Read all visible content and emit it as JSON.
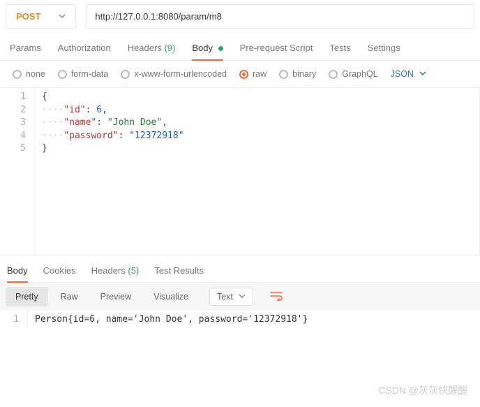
{
  "request": {
    "method": "POST",
    "url": "http://127.0.0.1:8080/param/m8"
  },
  "mainTabs": {
    "params": "Params",
    "authorization": "Authorization",
    "headers": "Headers",
    "headersCount": "(9)",
    "body": "Body",
    "prerequest": "Pre-request Script",
    "tests": "Tests",
    "settings": "Settings"
  },
  "bodyTypes": {
    "none": "none",
    "formdata": "form-data",
    "xwww": "x-www-form-urlencoded",
    "raw": "raw",
    "binary": "binary",
    "graphql": "GraphQL",
    "format": "JSON"
  },
  "editor": {
    "ln1": "1",
    "ln2": "2",
    "ln3": "3",
    "ln4": "4",
    "ln5": "5",
    "open": "{",
    "close": "}",
    "k_id": "\"id\"",
    "v_id": "6",
    "k_name": "\"name\"",
    "v_name": "\"John Doe\"",
    "k_pass": "\"password\"",
    "v_pass": "\"12372918\"",
    "colon_sp": ": ",
    "dots4": "····",
    "comma": ","
  },
  "respTabs": {
    "body": "Body",
    "cookies": "Cookies",
    "headers": "Headers",
    "headersCount": "(5)",
    "tests": "Test Results"
  },
  "respToolbar": {
    "pretty": "Pretty",
    "raw": "Raw",
    "preview": "Preview",
    "visualize": "Visualize",
    "text": "Text"
  },
  "response": {
    "ln1": "1",
    "body": "Person{id=6, name='John Doe', password='12372918'}"
  },
  "watermark": "CSDN @灰灰快醒醒"
}
